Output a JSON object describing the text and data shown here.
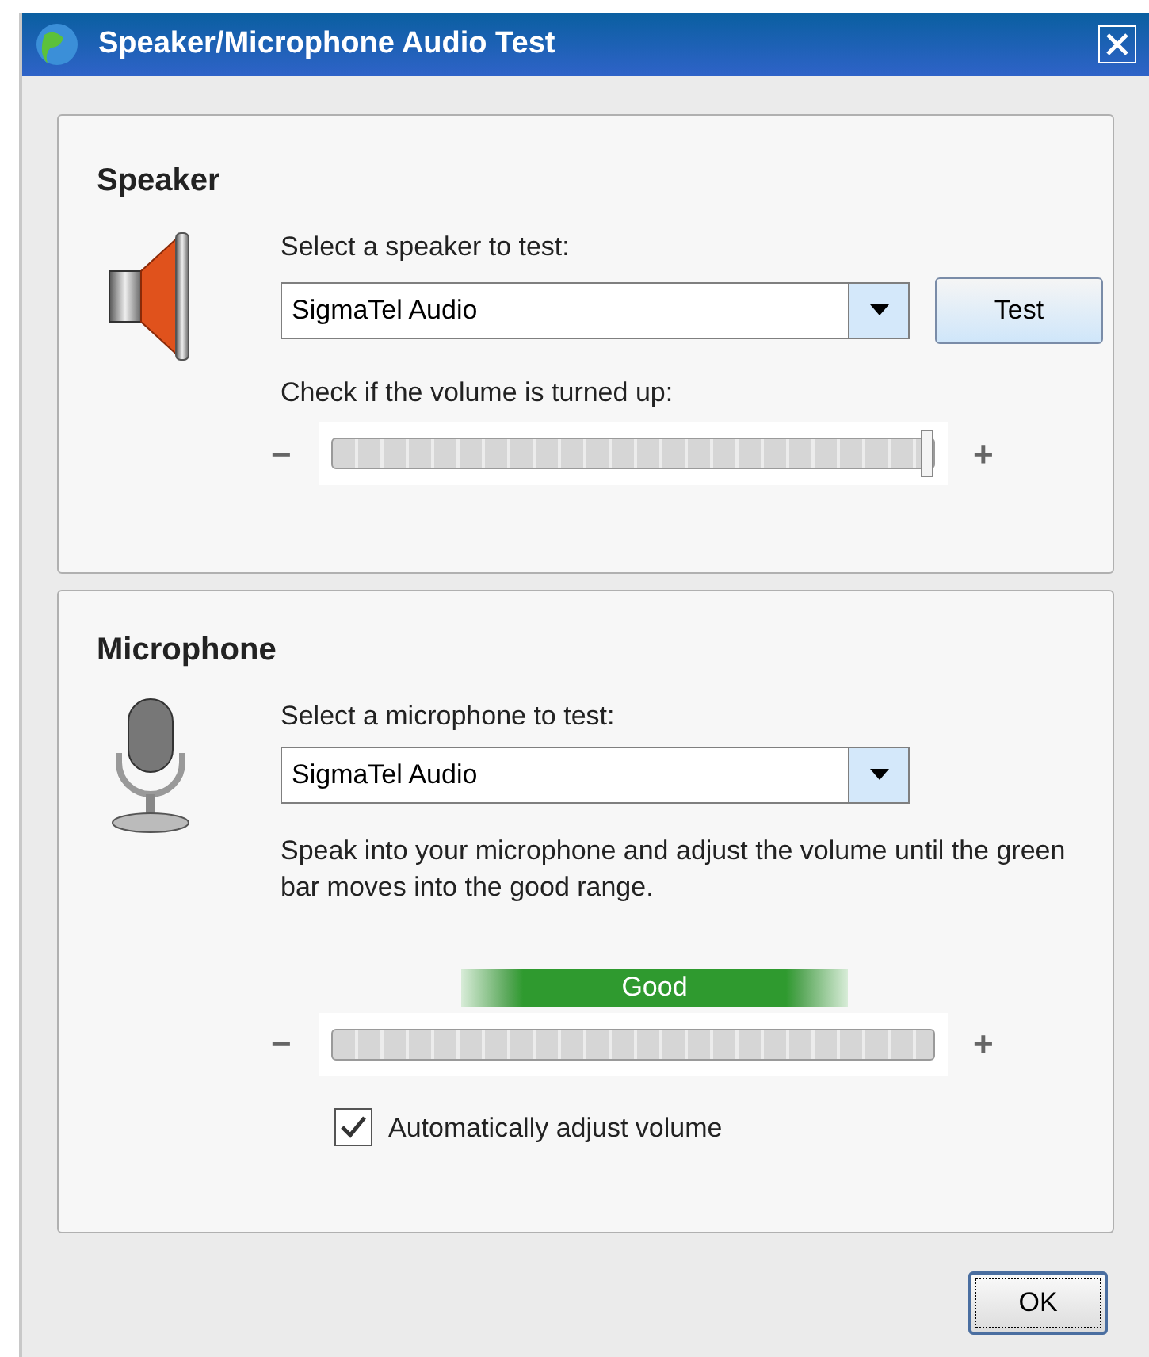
{
  "window": {
    "title": "Speaker/Microphone Audio Test"
  },
  "speaker": {
    "heading": "Speaker",
    "select_label": "Select a speaker to test:",
    "device": "SigmaTel Audio",
    "test_button": "Test",
    "volume_label": "Check if the volume is turned up:",
    "minus": "−",
    "plus": "+",
    "level": 1
  },
  "microphone": {
    "heading": "Microphone",
    "select_label": "Select a microphone to test:",
    "device": "SigmaTel Audio",
    "instructions": "Speak into your microphone and adjust the volume until the green bar moves into the good range.",
    "range_label": "Good",
    "minus": "−",
    "plus": "+",
    "auto_adjust": {
      "label": "Automatically adjust volume",
      "checked": true
    }
  },
  "buttons": {
    "ok": "OK"
  }
}
